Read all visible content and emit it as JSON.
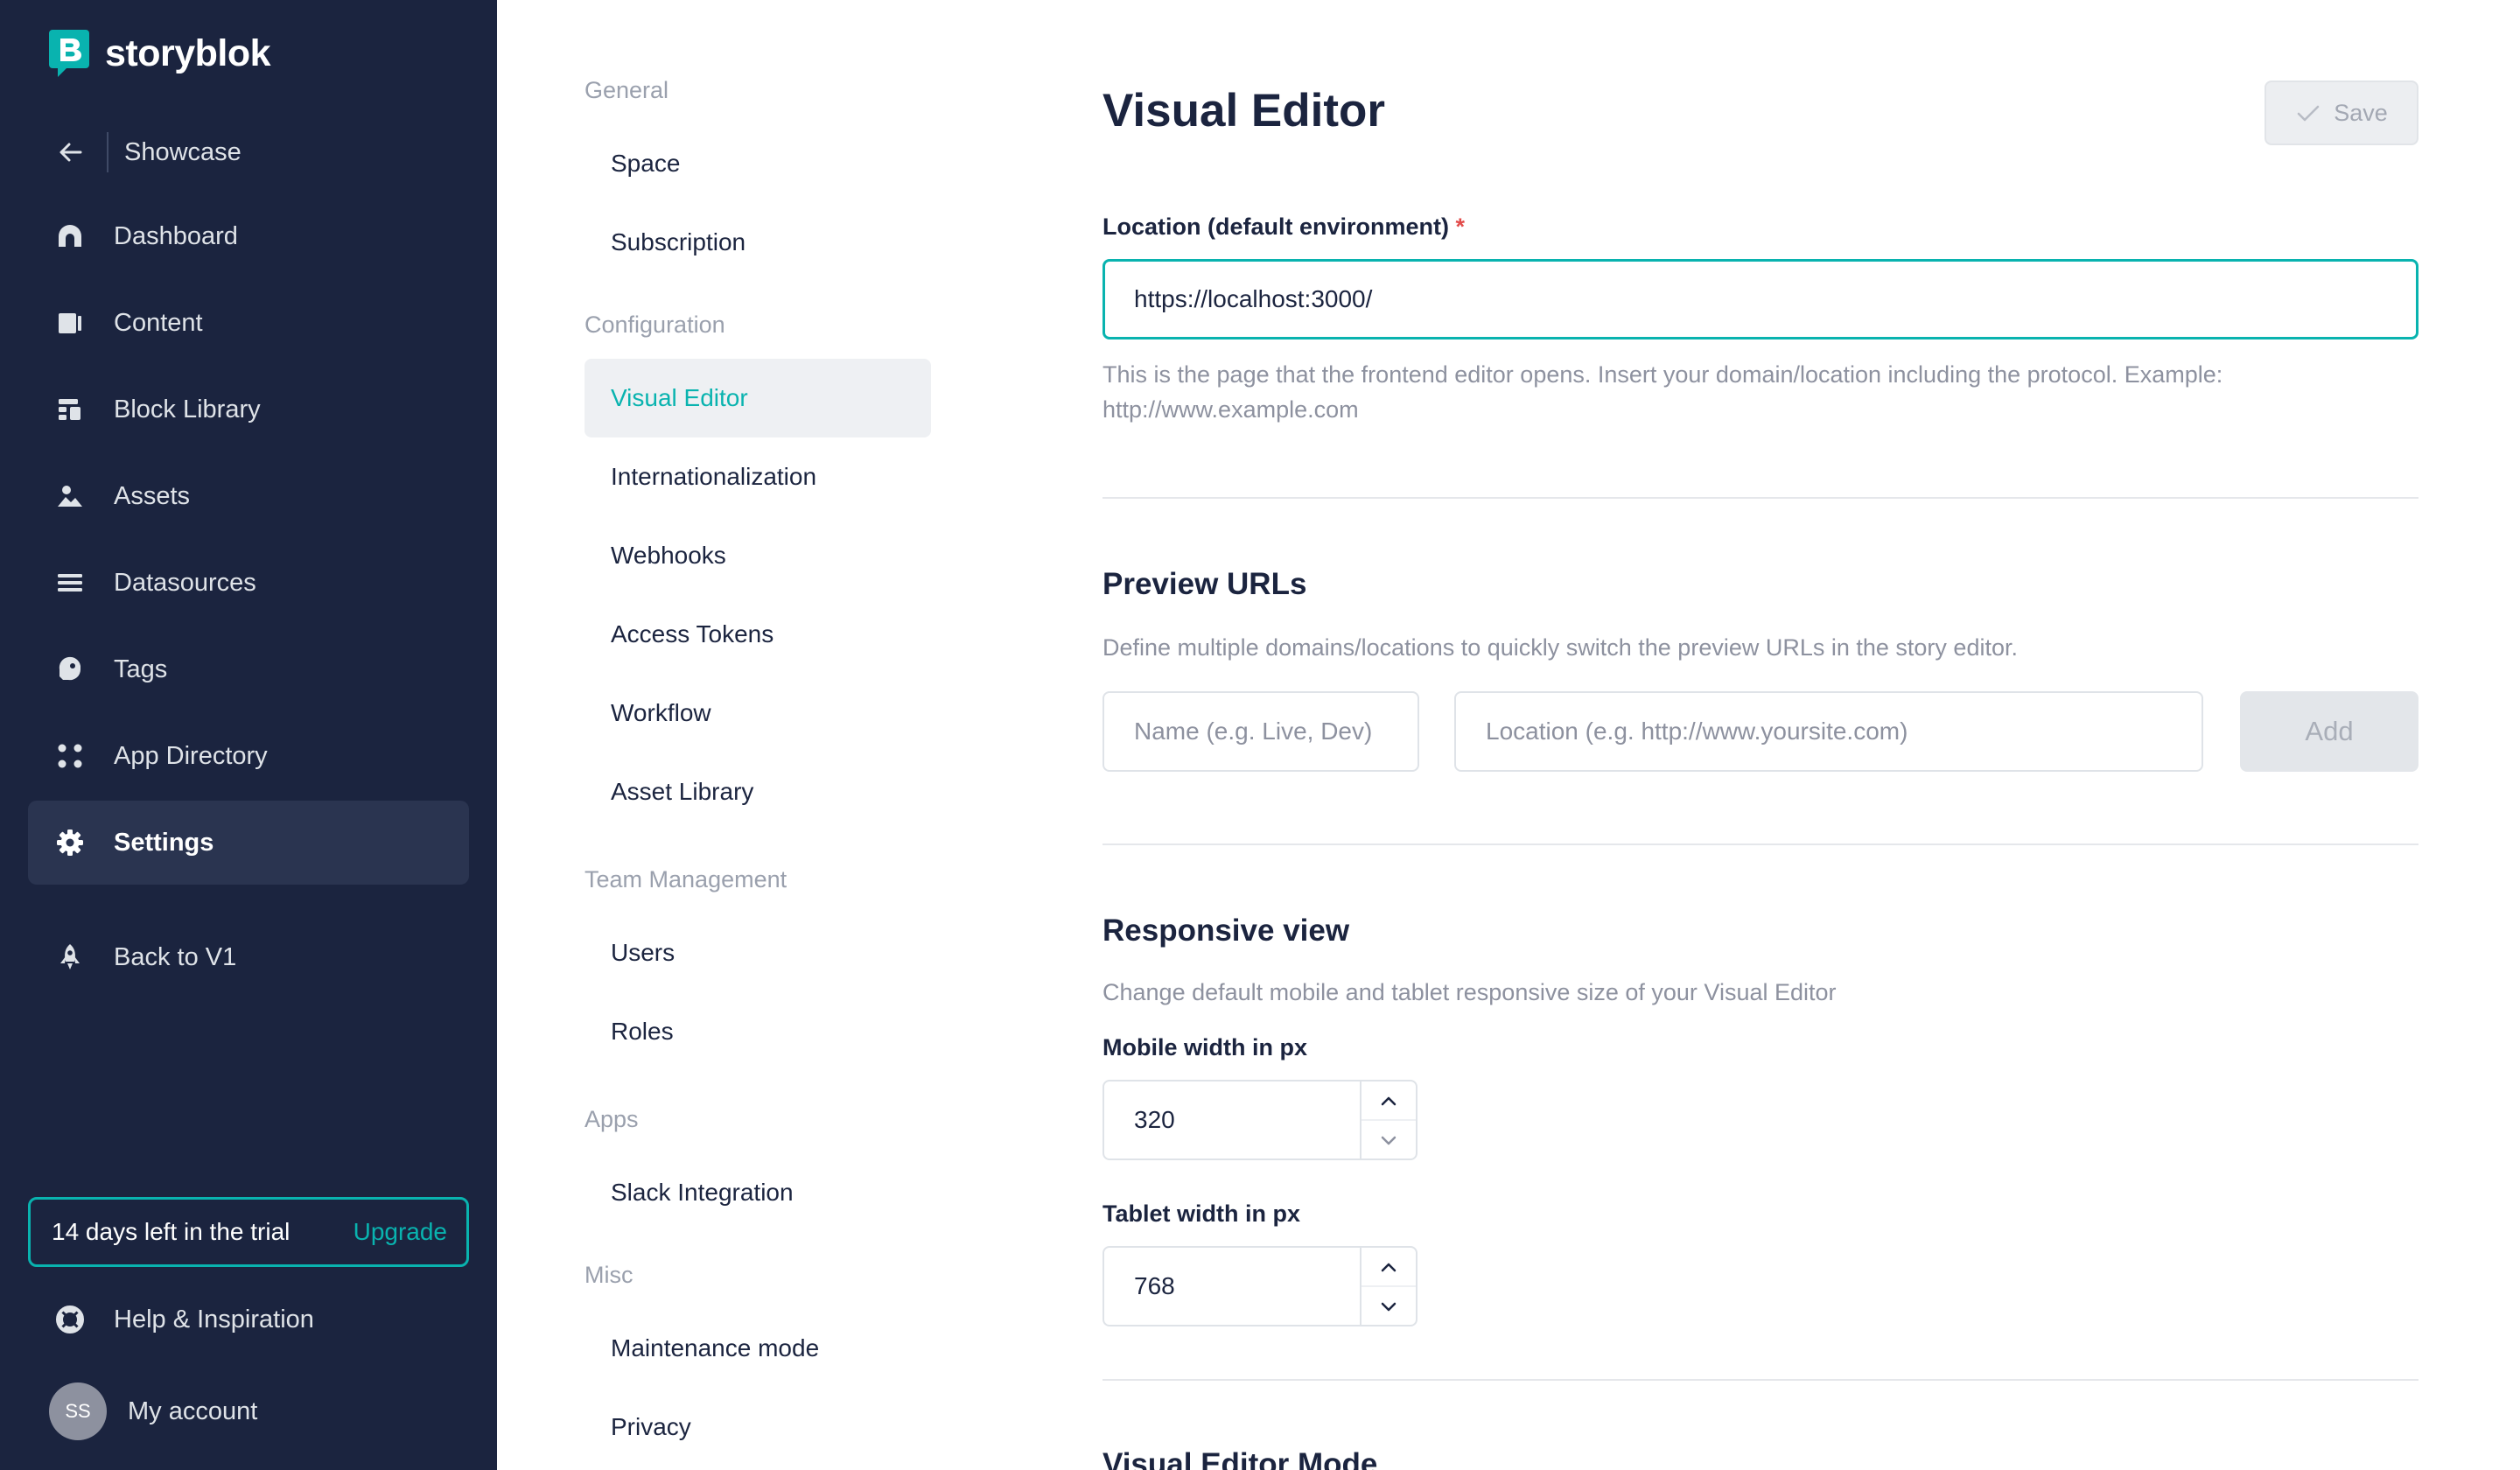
{
  "brand": {
    "name": "storyblok"
  },
  "space": {
    "name": "Showcase"
  },
  "sidebar": {
    "items": [
      {
        "label": "Dashboard",
        "icon": "dashboard-icon"
      },
      {
        "label": "Content",
        "icon": "content-icon"
      },
      {
        "label": "Block Library",
        "icon": "block-library-icon"
      },
      {
        "label": "Assets",
        "icon": "assets-icon"
      },
      {
        "label": "Datasources",
        "icon": "datasources-icon"
      },
      {
        "label": "Tags",
        "icon": "tag-icon"
      },
      {
        "label": "App Directory",
        "icon": "app-directory-icon"
      },
      {
        "label": "Settings",
        "icon": "gear-icon",
        "active": true
      }
    ],
    "back_v1": "Back to V1",
    "trial": {
      "text": "14 days left in the trial",
      "upgrade": "Upgrade"
    },
    "help": "Help & Inspiration",
    "account": {
      "initials": "SS",
      "label": "My account"
    }
  },
  "settings_menu": {
    "sections": [
      {
        "title": "General",
        "items": [
          "Space",
          "Subscription"
        ]
      },
      {
        "title": "Configuration",
        "items": [
          "Visual Editor",
          "Internationalization",
          "Webhooks",
          "Access Tokens",
          "Workflow",
          "Asset Library"
        ]
      },
      {
        "title": "Team Management",
        "items": [
          "Users",
          "Roles"
        ]
      },
      {
        "title": "Apps",
        "items": [
          "Slack Integration"
        ]
      },
      {
        "title": "Misc",
        "items": [
          "Maintenance mode",
          "Privacy"
        ]
      }
    ],
    "active_item": "Visual Editor"
  },
  "main": {
    "title": "Visual Editor",
    "save_label": "Save",
    "location": {
      "label": "Location (default environment)",
      "required_mark": "*",
      "value": "https://localhost:3000/",
      "help_line1": "This is the page that the frontend editor opens. Insert your domain/location including the protocol. Example:",
      "help_line2": "http://www.example.com"
    },
    "preview_urls": {
      "title": "Preview URLs",
      "description": "Define multiple domains/locations to quickly switch the preview URLs in the story editor.",
      "name_placeholder": "Name (e.g. Live, Dev)",
      "location_placeholder": "Location (e.g. http://www.yoursite.com)",
      "add_label": "Add"
    },
    "responsive": {
      "title": "Responsive view",
      "description": "Change default mobile and tablet responsive size of your Visual Editor",
      "mobile_label": "Mobile width in px",
      "mobile_value": "320",
      "tablet_label": "Tablet width in px",
      "tablet_value": "768"
    },
    "editor_mode": {
      "title": "Visual Editor Mode"
    }
  },
  "colors": {
    "sidebar_bg": "#1b243f",
    "accent": "#09b3af",
    "active_menu_bg": "#eef0f3",
    "required": "#e24c4b"
  }
}
